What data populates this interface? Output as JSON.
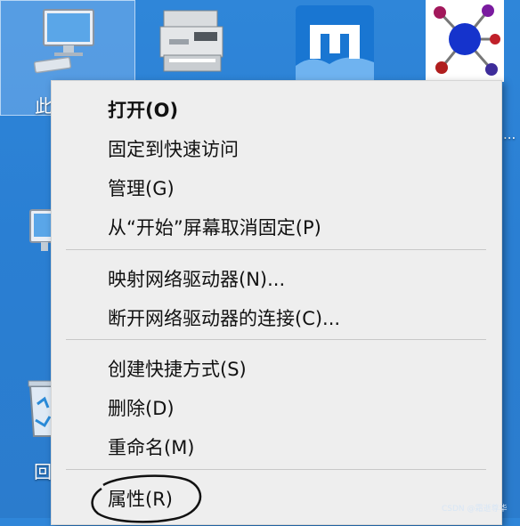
{
  "desktop": {
    "icons": [
      {
        "name": "this-pc",
        "label_visible": "此",
        "icon": "computer-icon"
      },
      {
        "name": "printer",
        "icon": "printer-icon"
      },
      {
        "name": "maxthon",
        "icon": "maxthon-icon"
      },
      {
        "name": "molecule",
        "icon": "molecule-icon"
      }
    ],
    "left_partial_labels": [
      "",
      "",
      "回"
    ],
    "edge_ellipsis": "..."
  },
  "context_menu": {
    "items": [
      {
        "label": "打开(O)",
        "bold": true
      },
      {
        "label": "固定到快速访问",
        "bold": false
      },
      {
        "label": "管理(G)",
        "bold": false
      },
      {
        "label": "从“开始”屏幕取消固定(P)",
        "bold": false
      },
      {
        "label": "映射网络驱动器(N)...",
        "bold": false
      },
      {
        "label": "断开网络驱动器的连接(C)...",
        "bold": false
      },
      {
        "label": "创建快捷方式(S)",
        "bold": false
      },
      {
        "label": "删除(D)",
        "bold": false
      },
      {
        "label": "重命名(M)",
        "bold": false
      },
      {
        "label": "属性(R)",
        "bold": false,
        "circled": true
      }
    ]
  },
  "watermark": "CSDN @霜逝尊华",
  "colors": {
    "desktop_bg": "#2f86d9",
    "menu_bg": "#eeeeee",
    "separator": "#c8c8c8",
    "text": "#111111"
  }
}
